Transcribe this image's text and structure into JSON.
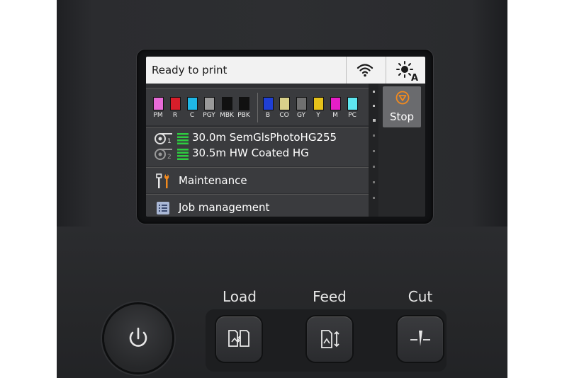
{
  "status_bar": {
    "status_text": "Ready to print",
    "wifi_icon": "wifi-icon",
    "brightness_icon": "auto-brightness-icon",
    "brightness_badge": "A"
  },
  "inks": [
    {
      "label": "PM",
      "color": "#e86bd8"
    },
    {
      "label": "R",
      "color": "#d81e2a"
    },
    {
      "label": "C",
      "color": "#1fb7e6"
    },
    {
      "label": "PGY",
      "color": "#9a9a9a"
    },
    {
      "label": "MBK",
      "color": "#111111"
    },
    {
      "label": "PBK",
      "color": "#111111"
    },
    {
      "label": "B",
      "color": "#1f3fd6"
    },
    {
      "label": "CO",
      "color": "#d8d08a"
    },
    {
      "label": "GY",
      "color": "#707070"
    },
    {
      "label": "Y",
      "color": "#e6c21a"
    },
    {
      "label": "M",
      "color": "#e61ec7"
    },
    {
      "label": "PC",
      "color": "#5ee6f0"
    }
  ],
  "rolls": [
    {
      "number": "1",
      "text": "30.0m  SemGlsPhotoHG255",
      "level": 1.0,
      "active": true
    },
    {
      "number": "2",
      "text": "30.5m  HW Coated HG",
      "level": 1.0,
      "active": false
    }
  ],
  "menu": {
    "maintenance_label": "Maintenance",
    "job_management_label": "Job management"
  },
  "stop": {
    "label": "Stop"
  },
  "hardware_buttons": {
    "load_label": "Load",
    "feed_label": "Feed",
    "cut_label": "Cut"
  },
  "colors": {
    "accent_orange": "#f28a1e",
    "level_green": "#2ecc40"
  }
}
